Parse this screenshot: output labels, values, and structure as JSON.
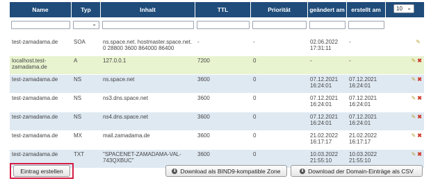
{
  "table": {
    "headers": {
      "name": "Name",
      "typ": "Typ",
      "inhalt": "Inhalt",
      "ttl": "TTL",
      "prio": "Priorität",
      "geaendert": "geändert am",
      "erstellt": "erstellt am"
    },
    "page_size": "10",
    "filters": {
      "name": "",
      "typ": "",
      "inhalt": "",
      "ttl": "",
      "prio": "",
      "geaendert": "",
      "erstellt": ""
    },
    "rows": [
      {
        "name": "test-zamadama.de",
        "typ": "SOA",
        "inhalt": "ns.space.net. hostmaster.space.net. 0 28800 3600 864000 86400",
        "ttl": "-",
        "prio": "-",
        "geaendert": "02.06.2022 17:31:11",
        "erstellt": "-",
        "delete": false
      },
      {
        "name": "localhost.test-zamadama.de",
        "typ": "A",
        "inhalt": "127.0.0.1",
        "ttl": "7200",
        "prio": "0",
        "geaendert": "-",
        "erstellt": "-",
        "delete": true
      },
      {
        "name": "test-zamadama.de",
        "typ": "NS",
        "inhalt": "ns.space.net",
        "ttl": "3600",
        "prio": "0",
        "geaendert": "07.12.2021 16:24:01",
        "erstellt": "07.12.2021 16:24:01",
        "delete": true
      },
      {
        "name": "test-zamadama.de",
        "typ": "NS",
        "inhalt": "ns3.dns.space.net",
        "ttl": "3600",
        "prio": "0",
        "geaendert": "07.12.2021 16:24:01",
        "erstellt": "07.12.2021 16:24:01",
        "delete": true
      },
      {
        "name": "test-zamadama.de",
        "typ": "NS",
        "inhalt": "ns4.dns.space.net",
        "ttl": "3600",
        "prio": "0",
        "geaendert": "07.12.2021 16:24:01",
        "erstellt": "07.12.2021 16:24:01",
        "delete": true
      },
      {
        "name": "test-zamadama.de",
        "typ": "MX",
        "inhalt": "mail.zamadama.de",
        "ttl": "3600",
        "prio": "0",
        "geaendert": "21.02.2022 16:17:17",
        "erstellt": "21.02.2022 16:17:17",
        "delete": true
      },
      {
        "name": "test-zamadama.de",
        "typ": "TXT",
        "inhalt": "\"SPACENET-ZAMADAMA-VAL-743QXBUC\"",
        "ttl": "3600",
        "prio": "0",
        "geaendert": "10.03.2022 21:55:10",
        "erstellt": "10.03.2022 21:55:10",
        "delete": true
      }
    ]
  },
  "buttons": {
    "create": "Eintrag erstellen",
    "download_bind": "Download als BIND9-kompatible Zone",
    "download_csv": "Download der Domain-Einträge als CSV"
  },
  "colors": {
    "header_bg": "#1f4c7a",
    "row_alt": "#dfe9f2",
    "row_highlight": "#e8f3cf",
    "create_border": "#d41c45"
  },
  "icons": {
    "edit": "pencil-icon",
    "delete": "cross-icon",
    "download": "download-circle-icon",
    "dropdown": "chevron-down-icon"
  }
}
